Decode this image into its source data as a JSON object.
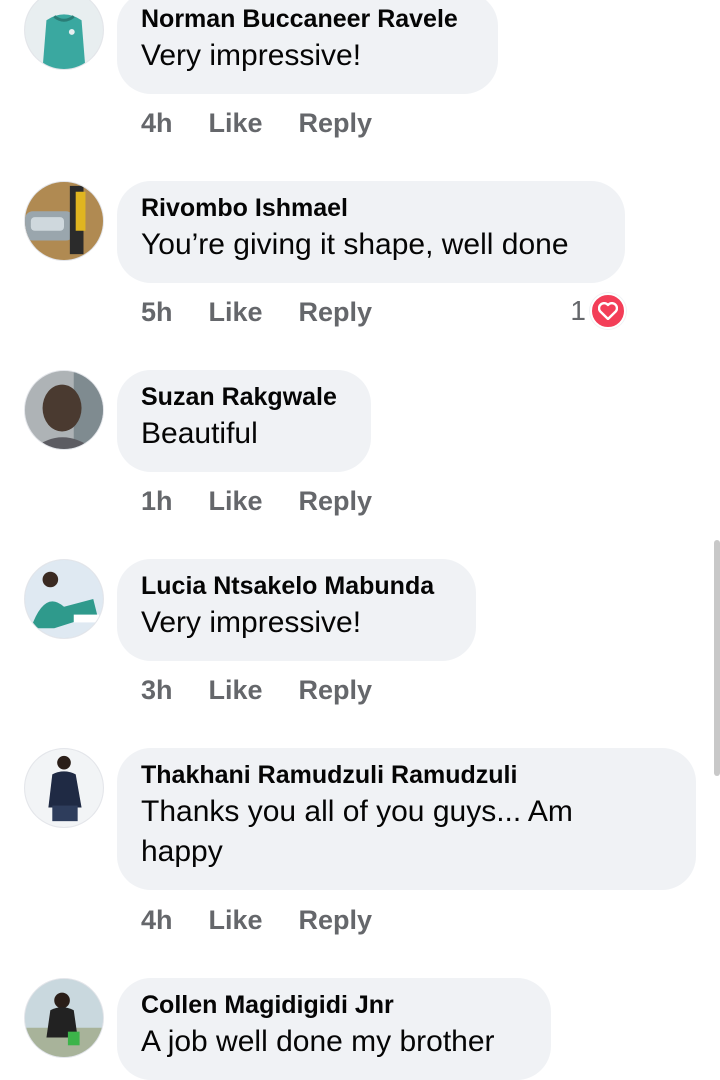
{
  "colors": {
    "bubble_bg": "#f0f2f5",
    "action_text": "#65676b",
    "love_reaction": "#f33e58"
  },
  "actions": {
    "like": "Like",
    "reply": "Reply"
  },
  "comments": [
    {
      "author": "Norman Buccaneer Ravele",
      "text": "Very impressive!",
      "time": "4h",
      "reaction_count": ""
    },
    {
      "author": "Rivombo Ishmael",
      "text": "You’re giving it shape, well done",
      "time": "5h",
      "reaction_count": "1",
      "reaction_icon": "heart-icon"
    },
    {
      "author": "Suzan Rakgwale",
      "text": "Beautiful",
      "time": "1h",
      "reaction_count": ""
    },
    {
      "author": "Lucia Ntsakelo Mabunda",
      "text": "Very impressive!",
      "time": "3h",
      "reaction_count": ""
    },
    {
      "author": "Thakhani Ramudzuli Ramudzuli",
      "text": "Thanks you all of you guys... Am happy",
      "time": "4h",
      "reaction_count": ""
    },
    {
      "author": "Collen Magidigidi Jnr",
      "text": "A job well done my brother",
      "time": "",
      "reaction_count": ""
    }
  ]
}
